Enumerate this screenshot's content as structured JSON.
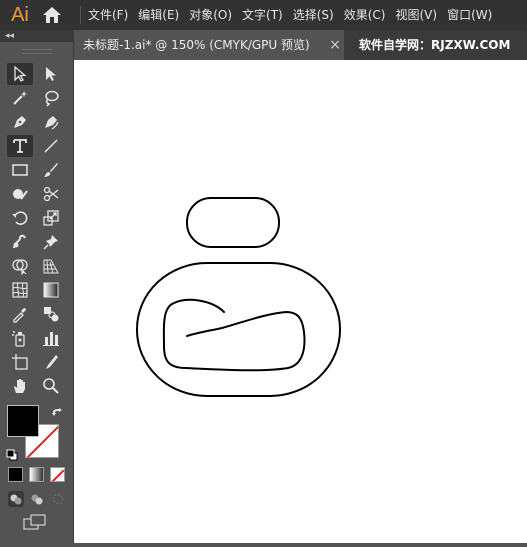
{
  "app": {
    "logo": "Ai",
    "home_icon": "home-icon"
  },
  "menu": {
    "items": [
      {
        "label": "文件(F)"
      },
      {
        "label": "编辑(E)"
      },
      {
        "label": "对象(O)"
      },
      {
        "label": "文字(T)"
      },
      {
        "label": "选择(S)"
      },
      {
        "label": "效果(C)"
      },
      {
        "label": "视图(V)"
      },
      {
        "label": "窗口(W)"
      }
    ]
  },
  "tabs": {
    "active": {
      "title": "未标题-1.ai* @ 150% (CMYK/GPU 预览)",
      "close": "×"
    },
    "banner": "软件自学网：RJZXW.COM"
  },
  "toolbar": {
    "collapse": "◂◂",
    "tools": [
      "selection-tool",
      "direct-selection-tool",
      "magic-wand-tool",
      "lasso-tool",
      "pen-tool",
      "curvature-tool",
      "type-tool",
      "line-segment-tool",
      "rectangle-tool",
      "paintbrush-tool",
      "shaper-tool",
      "scissors-tool",
      "rotate-tool",
      "scale-tool",
      "warp-tool",
      "puppet-warp-tool",
      "shape-builder-tool",
      "perspective-grid-tool",
      "mesh-tool",
      "gradient-tool",
      "eyedropper-tool",
      "blend-tool",
      "symbol-sprayer-tool",
      "column-graph-tool",
      "artboard-tool",
      "slice-tool",
      "hand-tool",
      "zoom-tool"
    ],
    "fill_color": "#000000",
    "stroke_color": "none"
  },
  "colors": {
    "menubar": "#323232",
    "panel": "#535353",
    "canvas": "#ffffff",
    "accent": "#f29a3a",
    "stroke_none": "#e02020"
  }
}
